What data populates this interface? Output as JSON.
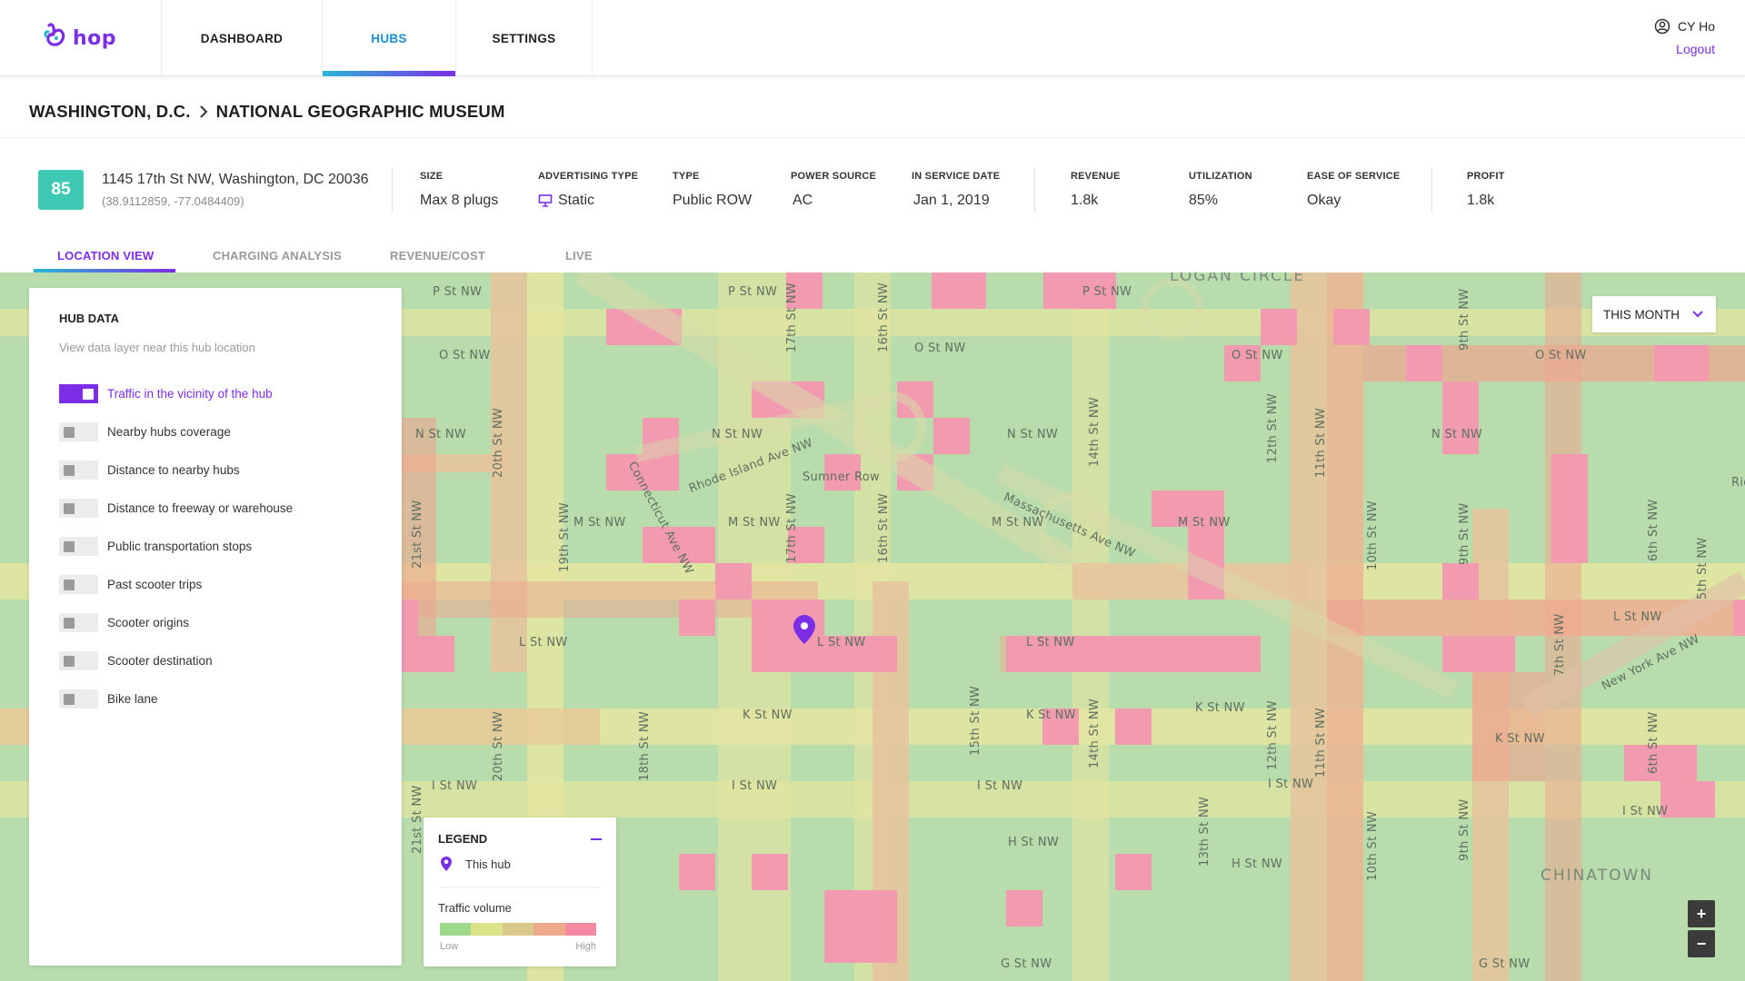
{
  "brand": {
    "name": "hop",
    "accent": "#7b2ee6",
    "accent_secondary": "#29b6d8"
  },
  "nav": {
    "tabs": [
      {
        "label": "DASHBOARD",
        "active": false
      },
      {
        "label": "HUBS",
        "active": true
      },
      {
        "label": "SETTINGS",
        "active": false
      }
    ],
    "user_name": "CY Ho",
    "logout_label": "Logout",
    "user_icon": "user-circle-icon"
  },
  "breadcrumb": {
    "city": "WASHINGTON, D.C.",
    "hub": "NATIONAL GEOGRAPHIC MUSEUM"
  },
  "hub": {
    "score": "85",
    "address": "1145 17th St NW, Washington, DC 20036",
    "coords": "(38.9112859, -77.0484409)",
    "stats": [
      {
        "label": "SIZE",
        "value": "Max 8 plugs"
      },
      {
        "label": "ADVERTISING TYPE",
        "value": "Static",
        "icon": "monitor-icon"
      },
      {
        "label": "TYPE",
        "value": "Public ROW"
      },
      {
        "label": "POWER SOURCE",
        "value": "AC"
      },
      {
        "label": "IN SERVICE DATE",
        "value": "Jan 1, 2019"
      },
      {
        "label": "REVENUE",
        "value": "1.8k"
      },
      {
        "label": "UTILIZATION",
        "value": "85%"
      },
      {
        "label": "EASE OF SERVICE",
        "value": "Okay"
      },
      {
        "label": "PROFIT",
        "value": "1.8k"
      }
    ]
  },
  "subtabs": [
    {
      "label": "LOCATION VIEW",
      "active": true
    },
    {
      "label": "CHARGING ANALYSIS",
      "active": false
    },
    {
      "label": "REVENUE/COST",
      "active": false
    },
    {
      "label": "LIVE",
      "active": false
    }
  ],
  "panel": {
    "title": "HUB DATA",
    "subtitle": "View data layer near this hub location",
    "layers": [
      {
        "label": "Traffic in the vicinity of the hub",
        "on": true
      },
      {
        "label": "Nearby hubs coverage",
        "on": false
      },
      {
        "label": "Distance to nearby hubs",
        "on": false
      },
      {
        "label": "Distance to freeway or warehouse",
        "on": false
      },
      {
        "label": "Public transportation stops",
        "on": false
      },
      {
        "label": "Past scooter trips",
        "on": false
      },
      {
        "label": "Scooter origins",
        "on": false
      },
      {
        "label": "Scooter destination",
        "on": false
      },
      {
        "label": "Bike lane",
        "on": false
      }
    ]
  },
  "period_select": {
    "value": "THIS MONTH"
  },
  "legend": {
    "title": "LEGEND",
    "hub_label": "This hub",
    "traffic_label": "Traffic volume",
    "low_label": "Low",
    "high_label": "High",
    "scale_colors": [
      "#9ed98c",
      "#d8e38a",
      "#d9c98a",
      "#eea98a",
      "#f58ba3"
    ]
  },
  "zoom": {
    "in": "+",
    "out": "−"
  },
  "map": {
    "neighborhoods": [
      "LOGAN CIRCLE",
      "CHINATOWN"
    ],
    "streets": [
      "P St NW",
      "O St NW",
      "N St NW",
      "M St NW",
      "L St NW",
      "K St NW",
      "I St NW",
      "H St NW",
      "G St NW",
      "Sumner Row",
      "Rhode Island Ave NW",
      "Massachusetts Ave NW",
      "Connecticut Ave NW",
      "New York Ave NW",
      "21st St NW",
      "20th St NW",
      "19th St NW",
      "18th St NW",
      "17th St NW",
      "16th St NW",
      "15th St NW",
      "14th St NW",
      "13th St NW",
      "12th St NW",
      "11th St NW",
      "10th St NW",
      "9th St NW",
      "7th St NW",
      "6th St NW",
      "5th St NW",
      "Ridg"
    ],
    "heat_colors": {
      "low": "#b8dcac",
      "mid": "#e4e5a0",
      "amber": "#e6c49c",
      "high": "#eea58f",
      "peak": "#f19ab0"
    }
  }
}
